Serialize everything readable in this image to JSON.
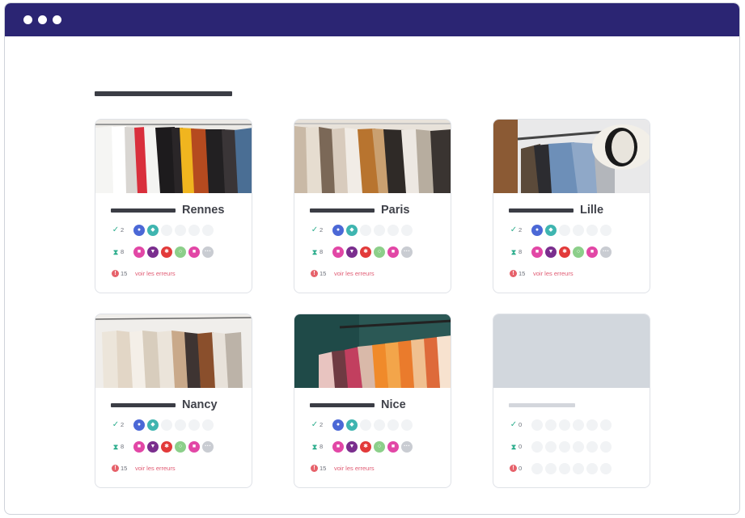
{
  "window": {
    "titlebar_color": "#2b2573"
  },
  "stats_labels": {
    "validated_count": "2",
    "pending_count": "8",
    "errors_count": "15",
    "errors_link": "voir les erreurs",
    "empty_count": "0"
  },
  "badge_colors": {
    "user": "#4b68d6",
    "teal": "#3fb5b0",
    "pink": "#e247a6",
    "purple": "#7a2e8e",
    "red": "#e23a3a",
    "green": "#8ccf8a",
    "more": "#c9ccd2"
  },
  "stores": [
    {
      "name": "Rennes",
      "image": "white-red-black-garments-on-rack"
    },
    {
      "name": "Paris",
      "image": "beige-brown-jackets-on-rack"
    },
    {
      "name": "Lille",
      "image": "denim-jacket-and-white-hat"
    },
    {
      "name": "Nancy",
      "image": "cream-and-brown-blouses-on-hangers"
    },
    {
      "name": "Nice",
      "image": "colorful-garments-teal-wall"
    }
  ],
  "placeholder_card": {
    "name": ""
  }
}
